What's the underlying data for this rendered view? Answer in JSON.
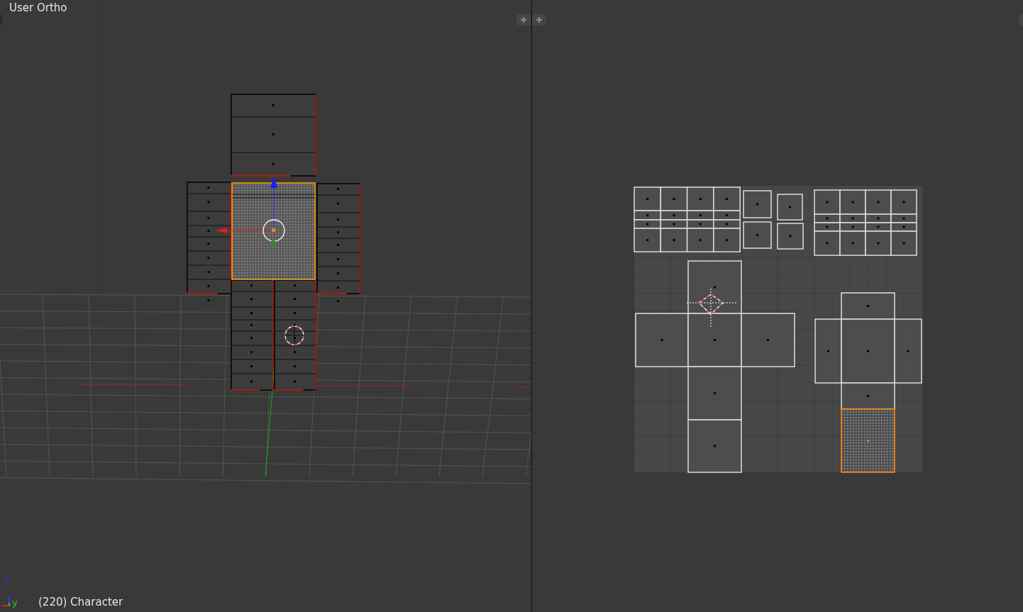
{
  "viewport": {
    "view_name": "User Ortho",
    "object_label": "(220) Character",
    "axis_labels": [
      "z",
      "y"
    ]
  },
  "uv_editor": {
    "faces": [
      {
        "selected": false
      },
      {
        "selected": false
      },
      {
        "selected": false
      },
      {
        "selected": false
      },
      {
        "selected": false
      },
      {
        "selected": false
      },
      {
        "selected": false
      },
      {
        "selected": false
      },
      {
        "selected": false
      },
      {
        "selected": false
      },
      {
        "selected": false
      },
      {
        "selected": true
      }
    ]
  }
}
